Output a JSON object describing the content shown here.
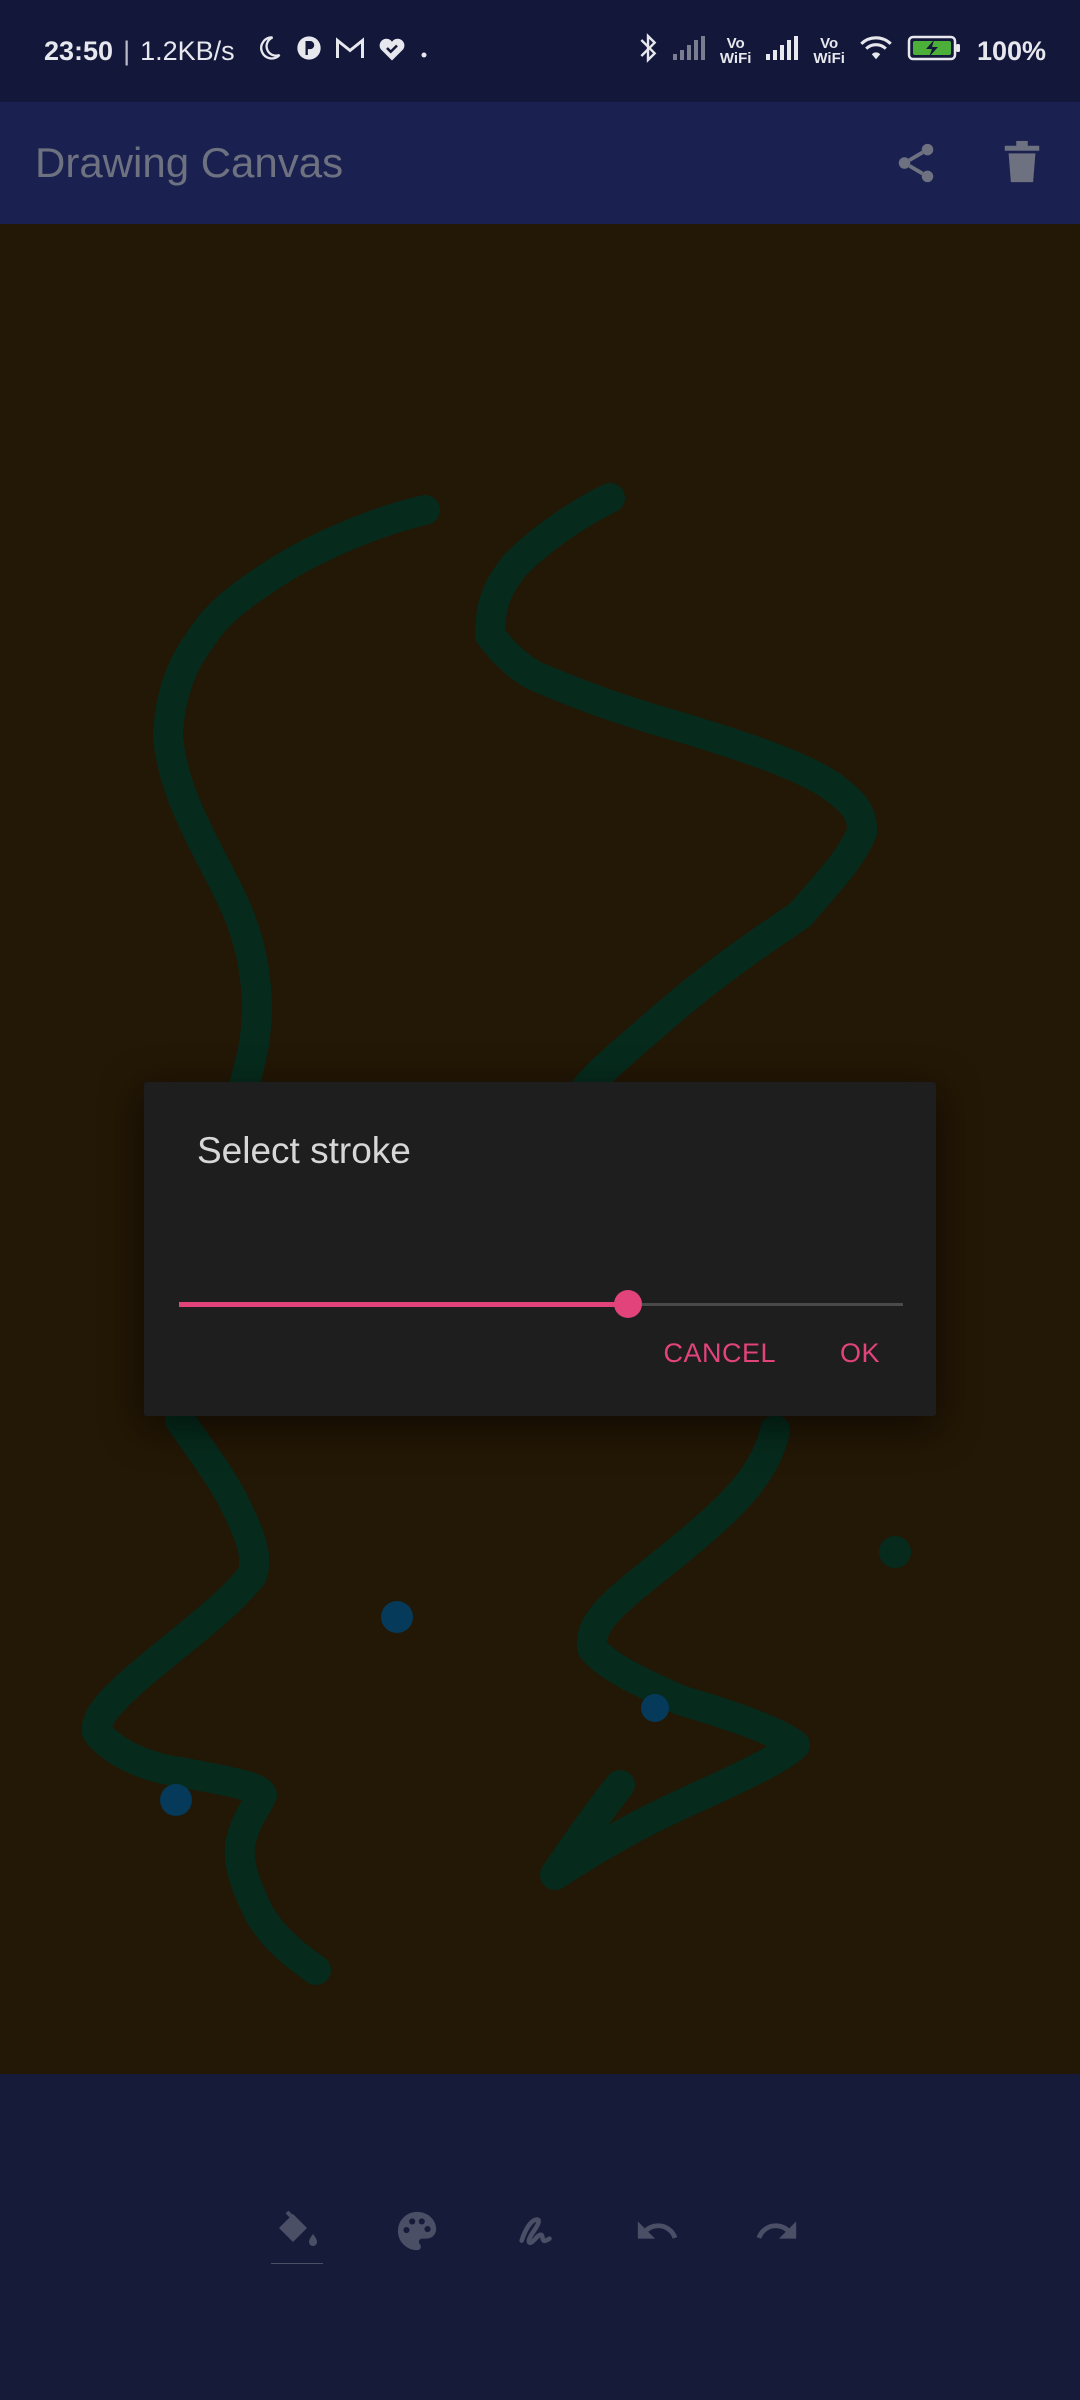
{
  "status_bar": {
    "time": "23:50",
    "separator": "|",
    "net_speed": "1.2KB/s",
    "vowifi_1": "Vo\nWiFi",
    "vowifi_2": "Vo\nWiFi",
    "battery_pct": "100%",
    "icons": [
      "moon-icon",
      "p-app-icon",
      "gmail-icon",
      "heart-check-icon",
      "dot-icon",
      "bluetooth-icon",
      "signal-icon",
      "wifi-icon",
      "battery-charging-icon"
    ]
  },
  "app_bar": {
    "title": "Drawing Canvas",
    "actions": [
      "share-icon",
      "delete-icon"
    ]
  },
  "dialog": {
    "title": "Select stroke",
    "slider_value": 0.62,
    "cancel_label": "CANCEL",
    "ok_label": "OK"
  },
  "toolbar": {
    "tools": [
      "fill-bucket-icon",
      "palette-icon",
      "stroke-icon",
      "undo-icon",
      "redo-icon"
    ],
    "selected": "fill-bucket-icon"
  },
  "colors": {
    "accent": "#e2437a",
    "canvas_bg": "#231705",
    "stroke_green": "#062b1d",
    "dot_blue": "#053a5a",
    "app_bar": "#1a2150",
    "status_bar": "#13173a"
  }
}
